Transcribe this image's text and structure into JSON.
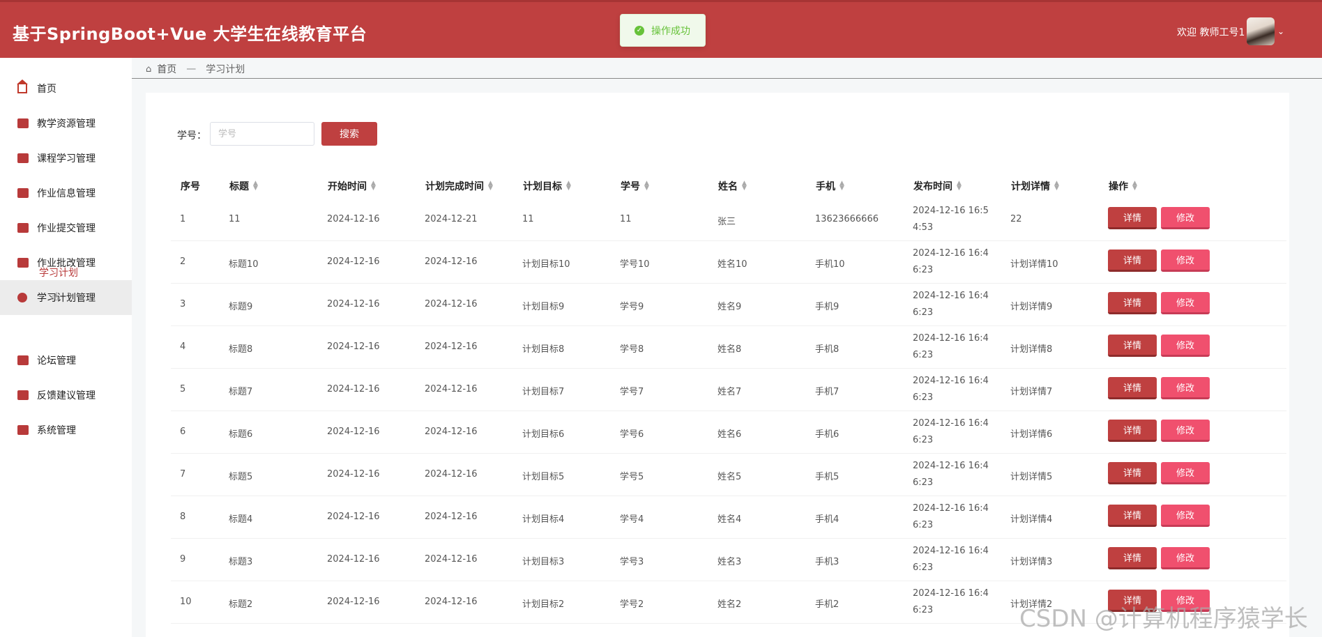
{
  "header": {
    "title": "基于SpringBoot+Vue 大学生在线教育平台",
    "toast": "操作成功",
    "welcome": "欢迎 教师工号1",
    "caret": "⌄"
  },
  "sidebar": {
    "items": [
      {
        "label": "首页",
        "icon": "home-icon"
      },
      {
        "label": "教学资源管理",
        "icon": "resource-icon"
      },
      {
        "label": "课程学习管理",
        "icon": "course-icon"
      },
      {
        "label": "作业信息管理",
        "icon": "homework-icon"
      },
      {
        "label": "作业提交管理",
        "icon": "submit-icon"
      },
      {
        "label": "作业批改管理",
        "icon": "grading-icon"
      },
      {
        "label": "学习计划管理",
        "icon": "plan-icon"
      },
      {
        "label": "论坛管理",
        "icon": "forum-icon"
      },
      {
        "label": "反馈建议管理",
        "icon": "feedback-icon"
      },
      {
        "label": "系统管理",
        "icon": "system-icon"
      }
    ],
    "submenu": "学习计划"
  },
  "breadcrumb": {
    "home": "首页",
    "separator": "—",
    "current": "学习计划"
  },
  "search": {
    "label": "学号：",
    "placeholder": "学号",
    "button": "搜索"
  },
  "table": {
    "columns": [
      "序号",
      "标题",
      "开始时间",
      "计划完成时间",
      "计划目标",
      "学号",
      "姓名",
      "手机",
      "发布时间",
      "计划详情",
      "操作"
    ],
    "detail_label": "详情",
    "edit_label": "修改",
    "rows": [
      {
        "no": "1",
        "title": "11",
        "start": "2024-12-16",
        "finish": "2024-12-21",
        "goal": "11",
        "sid": "11",
        "name": "张三",
        "phone": "13623666666",
        "pub": "2024-12-16 16:54:53",
        "detail": "22"
      },
      {
        "no": "2",
        "title": "标题10",
        "start": "2024-12-16",
        "finish": "2024-12-16",
        "goal": "计划目标10",
        "sid": "学号10",
        "name": "姓名10",
        "phone": "手机10",
        "pub": "2024-12-16 16:46:23",
        "detail": "计划详情10"
      },
      {
        "no": "3",
        "title": "标题9",
        "start": "2024-12-16",
        "finish": "2024-12-16",
        "goal": "计划目标9",
        "sid": "学号9",
        "name": "姓名9",
        "phone": "手机9",
        "pub": "2024-12-16 16:46:23",
        "detail": "计划详情9"
      },
      {
        "no": "4",
        "title": "标题8",
        "start": "2024-12-16",
        "finish": "2024-12-16",
        "goal": "计划目标8",
        "sid": "学号8",
        "name": "姓名8",
        "phone": "手机8",
        "pub": "2024-12-16 16:46:23",
        "detail": "计划详情8"
      },
      {
        "no": "5",
        "title": "标题7",
        "start": "2024-12-16",
        "finish": "2024-12-16",
        "goal": "计划目标7",
        "sid": "学号7",
        "name": "姓名7",
        "phone": "手机7",
        "pub": "2024-12-16 16:46:23",
        "detail": "计划详情7"
      },
      {
        "no": "6",
        "title": "标题6",
        "start": "2024-12-16",
        "finish": "2024-12-16",
        "goal": "计划目标6",
        "sid": "学号6",
        "name": "姓名6",
        "phone": "手机6",
        "pub": "2024-12-16 16:46:23",
        "detail": "计划详情6"
      },
      {
        "no": "7",
        "title": "标题5",
        "start": "2024-12-16",
        "finish": "2024-12-16",
        "goal": "计划目标5",
        "sid": "学号5",
        "name": "姓名5",
        "phone": "手机5",
        "pub": "2024-12-16 16:46:23",
        "detail": "计划详情5"
      },
      {
        "no": "8",
        "title": "标题4",
        "start": "2024-12-16",
        "finish": "2024-12-16",
        "goal": "计划目标4",
        "sid": "学号4",
        "name": "姓名4",
        "phone": "手机4",
        "pub": "2024-12-16 16:46:23",
        "detail": "计划详情4"
      },
      {
        "no": "9",
        "title": "标题3",
        "start": "2024-12-16",
        "finish": "2024-12-16",
        "goal": "计划目标3",
        "sid": "学号3",
        "name": "姓名3",
        "phone": "手机3",
        "pub": "2024-12-16 16:46:23",
        "detail": "计划详情3"
      },
      {
        "no": "10",
        "title": "标题2",
        "start": "2024-12-16",
        "finish": "2024-12-16",
        "goal": "计划目标2",
        "sid": "学号2",
        "name": "姓名2",
        "phone": "手机2",
        "pub": "2024-12-16 16:46:23",
        "detail": "计划详情2"
      }
    ]
  },
  "watermark": "CSDN @计算机程序猿学长",
  "colors": {
    "brand": "#bf4040",
    "edit": "#f0506e",
    "success": "#67c23a"
  }
}
